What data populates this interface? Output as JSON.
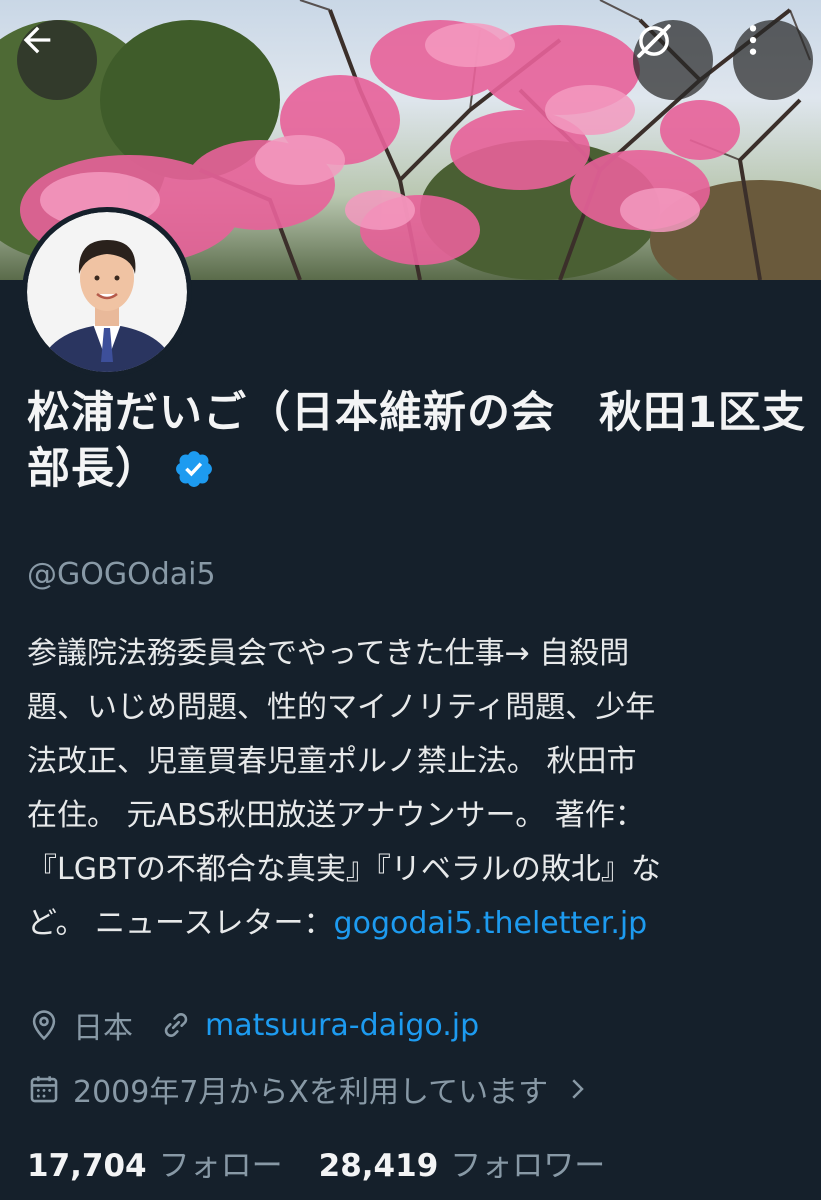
{
  "header": {
    "back_icon": "arrow-left-icon",
    "grok_icon": "grok-icon",
    "more_icon": "more-vertical-icon"
  },
  "profile": {
    "display_name": "松浦だいご（日本維新の会　秋田1区支部長）",
    "verified_icon": "verified-badge-icon",
    "handle": "@GOGOdai5",
    "bio_text": "参議院法務委員会でやってきた仕事→ 自殺問\n題、いじめ問題、性的マイノリティ問題、少年\n法改正、児童買春児童ポルノ禁止法。 秋田市\n在住。 元ABS秋田放送アナウンサー。 著作：\n『LGBTの不都合な真実』『リベラルの敗北』な\nど。 ニュースレター：",
    "bio_link": "gogodai5.theletter.jp",
    "location": "日本",
    "website": "matsuura-daigo.jp",
    "joined": "2009年7月からXを利用しています",
    "following_count": "17,704",
    "following_label": "フォロー",
    "followers_count": "28,419",
    "followers_label": "フォロワー"
  },
  "colors": {
    "background": "#15202b",
    "link": "#1d9bf0",
    "verified": "#1d9bf0",
    "secondary_text": "#8899a6"
  }
}
